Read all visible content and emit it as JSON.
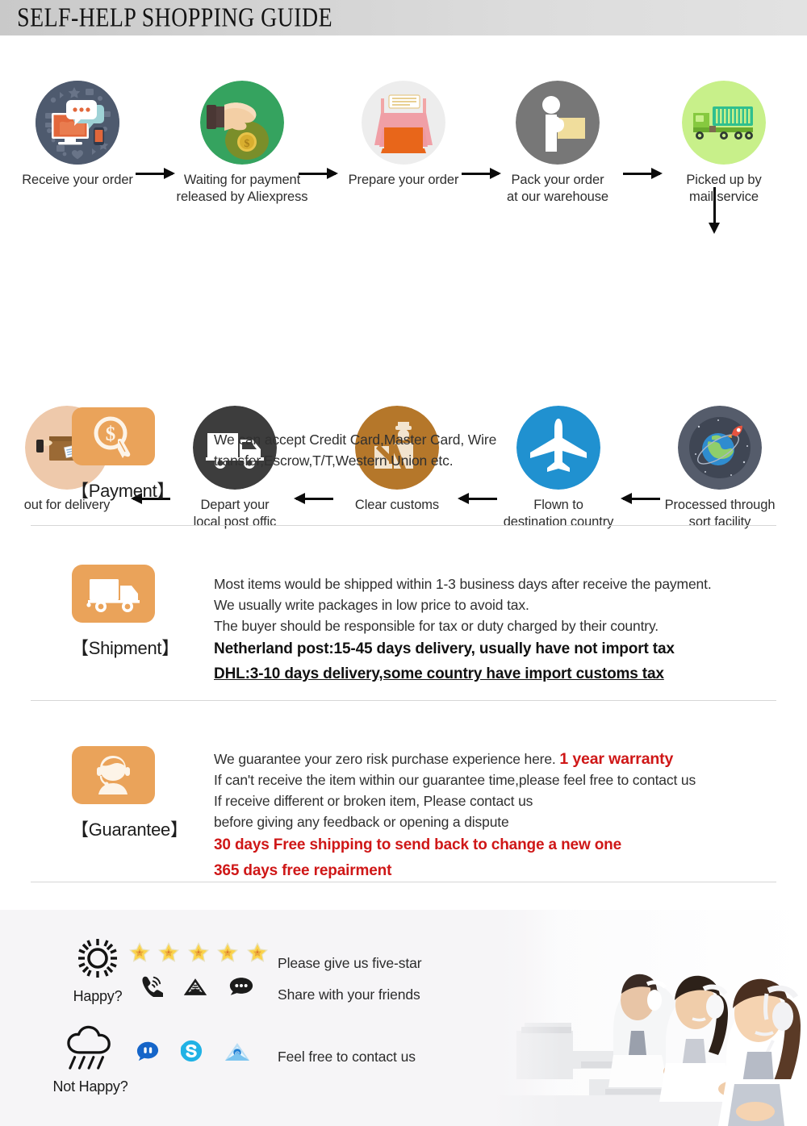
{
  "header": {
    "title": "SELF-HELP SHOPPING GUIDE"
  },
  "flow": {
    "row1": [
      {
        "icon": "desktop-chat-icon",
        "label_line1": "Receive your order",
        "label_line2": ""
      },
      {
        "icon": "hand-money-bag-icon",
        "label_line1": "Waiting for payment",
        "label_line2": "released by Aliexpress"
      },
      {
        "icon": "printer-icon",
        "label_line1": "Prepare your order",
        "label_line2": ""
      },
      {
        "icon": "worker-box-icon",
        "label_line1": "Pack your order",
        "label_line2": "at our warehouse"
      },
      {
        "icon": "cargo-truck-icon",
        "label_line1": "Picked up by",
        "label_line2": "mail service"
      }
    ],
    "row2": [
      {
        "icon": "parcel-package-icon",
        "label_line1": "out for delivery",
        "label_line2": ""
      },
      {
        "icon": "delivery-van-icon",
        "label_line1": "Depart your",
        "label_line2": "local post offic"
      },
      {
        "icon": "customs-officer-icon",
        "label_line1": "Clear customs",
        "label_line2": ""
      },
      {
        "icon": "airplane-icon",
        "label_line1": "Flown to",
        "label_line2": "destination country"
      },
      {
        "icon": "globe-rocket-icon",
        "label_line1": "Processed through",
        "label_line2": "sort facility"
      }
    ]
  },
  "sections": {
    "payment": {
      "icon": "dollar-coin-click-icon",
      "title": "【Payment】",
      "lines": [
        "We can accept Credit Card,Master Card, Wire",
        "transfer,Escrow,T/T,Western Union etc."
      ]
    },
    "shipment": {
      "icon": "truck-icon",
      "title": "【Shipment】",
      "lines": [
        "Most items would be shipped within 1-3 business days after receive the payment.",
        "We usually write packages in low price to avoid tax.",
        "The buyer should be responsible for tax or duty charged by their country."
      ],
      "bold_line": "Netherland post:15-45 days delivery, usually have not import tax",
      "bold_underline_line": "DHL:3-10 days delivery,some country have import customs tax"
    },
    "guarantee": {
      "icon": "headset-agent-icon",
      "title": "【Guarantee】",
      "line1_normal": "We guarantee your zero risk purchase experience here.",
      "line1_warranty": "1 year warranty",
      "lines": [
        "If can't receive the item within our guarantee time,please feel free to contact us",
        "If receive different or broken item, Please contact us",
        "before giving any feedback or opening a dispute"
      ],
      "red_lines": [
        "30 days Free shipping to send back to change a new one",
        "365 days free repairment"
      ]
    }
  },
  "footer": {
    "happy": {
      "icon": "sun-icon",
      "label": "Happy?",
      "stars": 5,
      "star_icon": "star-icon",
      "channels": [
        {
          "icon": "phone-call-icon"
        },
        {
          "icon": "envelope-mail-icon"
        },
        {
          "icon": "chat-bubble-icon"
        }
      ],
      "messages": [
        "Please give us five-star",
        "Share with your friends"
      ]
    },
    "not_happy": {
      "icon": "rain-cloud-icon",
      "label": "Not Happy?",
      "channels": [
        {
          "icon": "trademanager-icon"
        },
        {
          "icon": "skype-icon"
        },
        {
          "icon": "email-envelope-icon"
        }
      ],
      "message": "Feel free to contact us"
    },
    "photo": {
      "name": "call-center-agents-photo"
    }
  },
  "colors": {
    "accent_orange": "#EAA35A",
    "warranty_red": "#CF1717",
    "header_gray": "#D2D2D2"
  }
}
